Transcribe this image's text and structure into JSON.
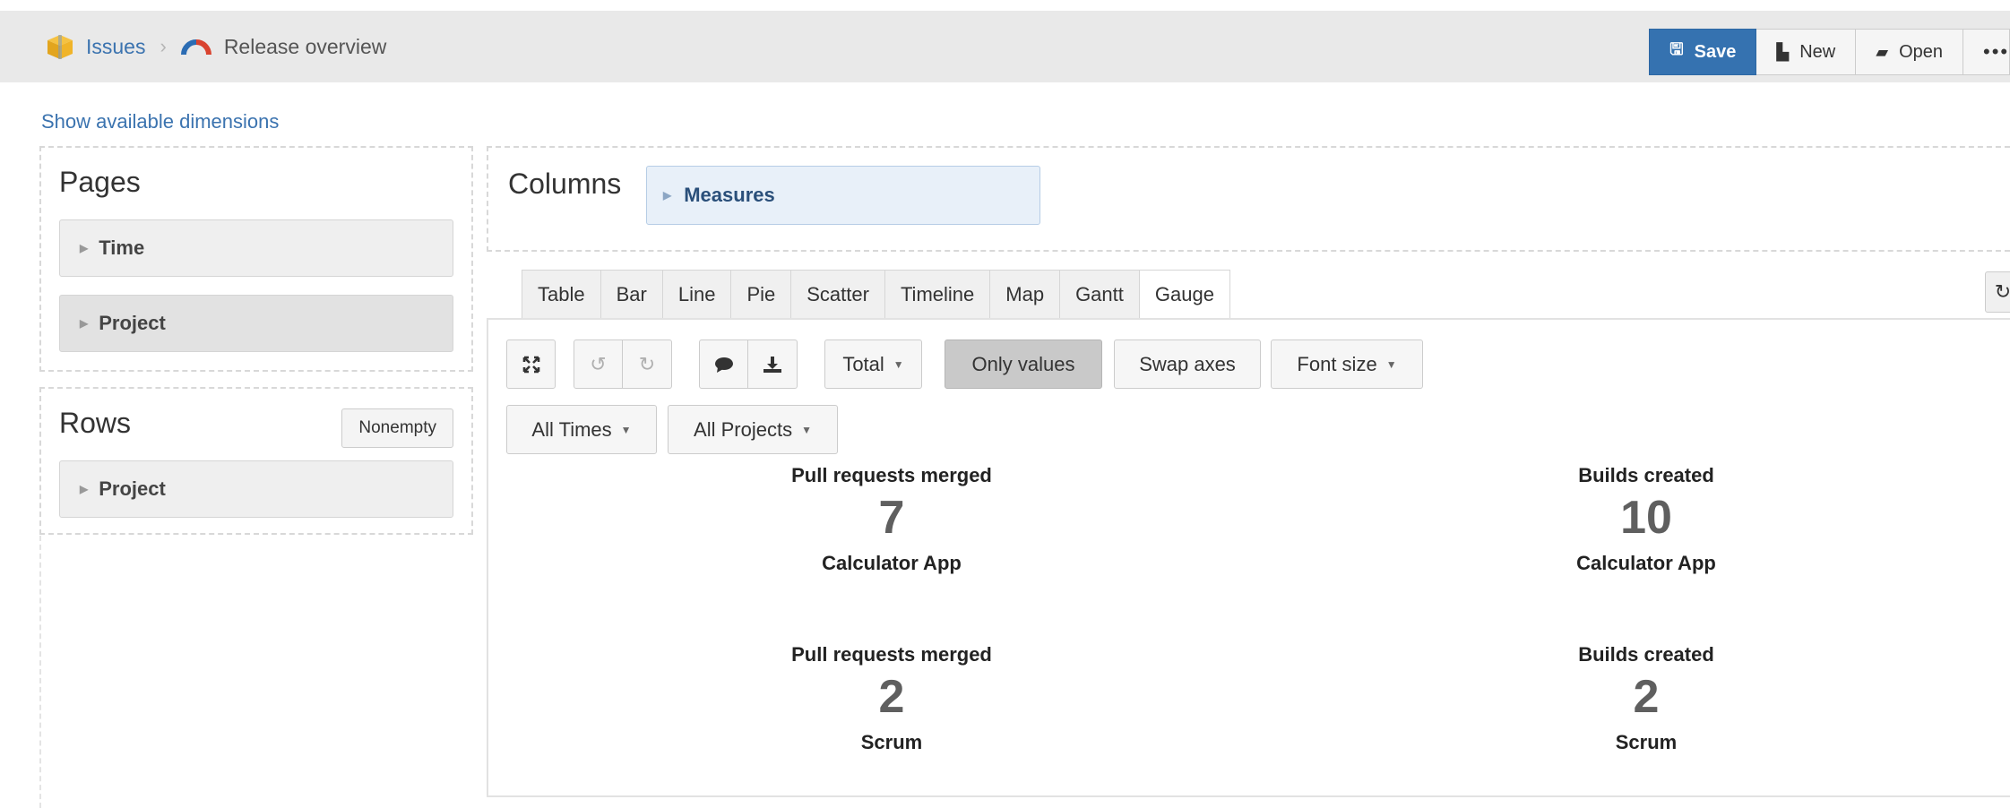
{
  "breadcrumb": {
    "root_label": "Issues",
    "current_label": "Release overview"
  },
  "actions": {
    "save_label": "Save",
    "new_label": "New",
    "open_label": "Open",
    "more_label": "•••"
  },
  "show_dimensions_label": "Show available dimensions",
  "pages": {
    "title": "Pages",
    "items": [
      {
        "label": "Time"
      },
      {
        "label": "Project"
      }
    ]
  },
  "rows": {
    "title": "Rows",
    "nonempty_label": "Nonempty",
    "items": [
      {
        "label": "Project"
      }
    ]
  },
  "columns": {
    "title": "Columns",
    "items": [
      {
        "label": "Measures"
      }
    ]
  },
  "tabs": [
    {
      "label": "Table"
    },
    {
      "label": "Bar"
    },
    {
      "label": "Line"
    },
    {
      "label": "Pie"
    },
    {
      "label": "Scatter"
    },
    {
      "label": "Timeline"
    },
    {
      "label": "Map"
    },
    {
      "label": "Gantt"
    },
    {
      "label": "Gauge",
      "active": true
    }
  ],
  "toolbar": {
    "total_label": "Total",
    "only_values_label": "Only values",
    "swap_axes_label": "Swap axes",
    "font_size_label": "Font size",
    "all_times_label": "All Times",
    "all_projects_label": "All Projects"
  },
  "icons": {
    "fullscreen": "expand-icon",
    "undo": "undo-icon",
    "redo": "redo-icon",
    "comment": "comment-icon",
    "export": "download-icon",
    "refresh": "refresh-icon",
    "app_logo": "issues-box-icon",
    "report": "gauge-icon"
  },
  "colors": {
    "primary": "#3572b0",
    "link": "#3b73af",
    "value": "#5f5f5f"
  },
  "gauges": [
    {
      "measure": "Pull requests merged",
      "value": "7",
      "project": "Calculator App"
    },
    {
      "measure": "Builds created",
      "value": "10",
      "project": "Calculator App"
    },
    {
      "measure": "Pull requests merged",
      "value": "2",
      "project": "Scrum"
    },
    {
      "measure": "Builds created",
      "value": "2",
      "project": "Scrum"
    }
  ]
}
